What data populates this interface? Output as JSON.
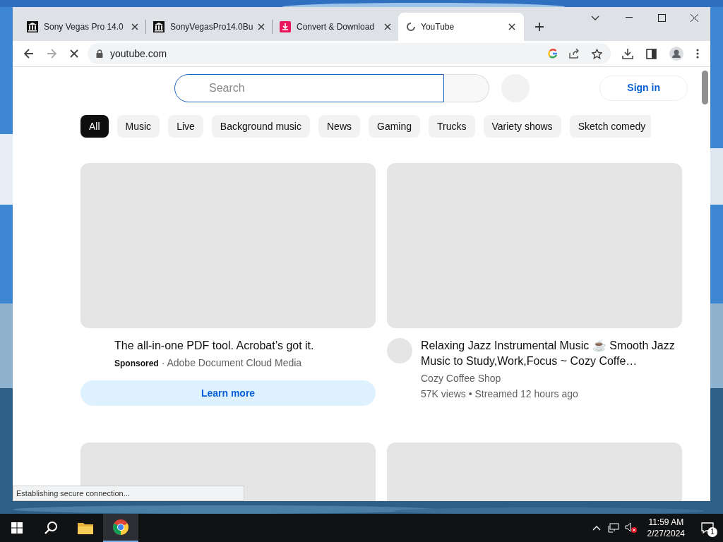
{
  "tabs": [
    {
      "title": "Sony Vegas Pro 14.0",
      "kind": "columns",
      "selected": false
    },
    {
      "title": "SonyVegasPro14.0Bu",
      "kind": "columns",
      "selected": false
    },
    {
      "title": "Convert & Download",
      "kind": "download",
      "selected": false
    },
    {
      "title": "YouTube",
      "kind": "loading",
      "selected": true
    }
  ],
  "address": "youtube.com",
  "page": {
    "search": {
      "placeholder": "Search"
    },
    "sign_in": "Sign in",
    "chips": [
      {
        "label": "All",
        "selected": true
      },
      {
        "label": "Music",
        "selected": false
      },
      {
        "label": "Live",
        "selected": false
      },
      {
        "label": "Background music",
        "selected": false
      },
      {
        "label": "News",
        "selected": false
      },
      {
        "label": "Gaming",
        "selected": false
      },
      {
        "label": "Trucks",
        "selected": false
      },
      {
        "label": "Variety shows",
        "selected": false
      },
      {
        "label": "Sketch comedy",
        "selected": false
      }
    ],
    "items": [
      {
        "kind": "ad",
        "title": "The all-in-one PDF tool. Acrobat’s got it.",
        "sponsored": "Sponsored",
        "advertiser": "· Adobe Document Cloud Media",
        "button": "Learn more"
      },
      {
        "kind": "video",
        "title": "Relaxing Jazz Instrumental Music ☕ Smooth Jazz Music to Study,Work,Focus ~ Cozy Coffe…",
        "channel": "Cozy Coffee Shop",
        "meta": "57K views • Streamed 12 hours ago"
      }
    ]
  },
  "status": "Establishing secure connection...",
  "taskbar": {
    "time": "11:59 AM",
    "date": "2/27/2024",
    "notifications": "1"
  }
}
